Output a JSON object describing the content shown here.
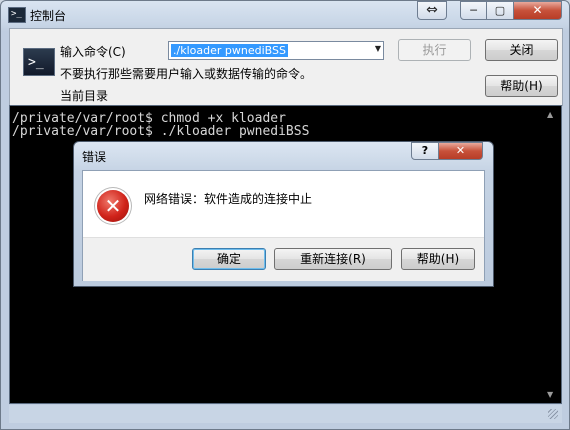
{
  "window": {
    "title": "控制台",
    "icon_glyph": ">_",
    "caption_swap": "⇔",
    "caption_minimize": "─",
    "caption_maximize": "▢",
    "caption_close": "✕"
  },
  "panel": {
    "command_label": "输入命令(C)",
    "hint": "不要执行那些需要用户输入或数据传输的命令。",
    "current_dir_label": "当前目录",
    "command_value": "./kloader pwnediBSS",
    "execute_label": "执行",
    "close_label": "关闭",
    "help_label": "帮助(H)"
  },
  "terminal": {
    "lines": [
      "/private/var/root$ chmod +x kloader",
      "/private/var/root$ ./kloader pwnediBSS"
    ]
  },
  "dialog": {
    "title": "错误",
    "help_glyph": "?",
    "close_glyph": "✕",
    "error_glyph": "✕",
    "message": "网络错误：软件造成的连接中止",
    "ok_label": "确定",
    "reconnect_label": "重新连接(R)",
    "help_label": "帮助(H)"
  },
  "colors": {
    "terminal_bg": "#000000",
    "selection": "#3399ff",
    "error_red": "#d0231a"
  }
}
